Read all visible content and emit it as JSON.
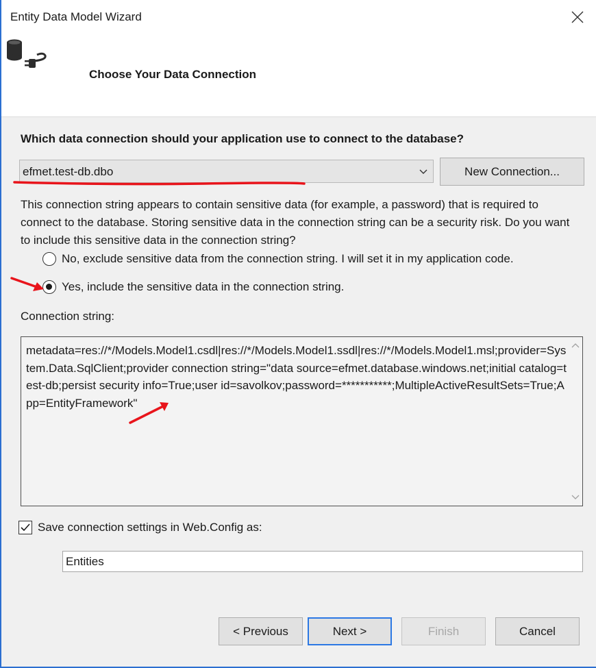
{
  "window": {
    "title": "Entity Data Model Wizard",
    "accent_color": "#2b6fd1"
  },
  "header": {
    "heading": "Choose Your Data Connection",
    "icon": "database-plug-icon"
  },
  "connection": {
    "question": "Which data connection should your application use to connect to the database?",
    "selected": "efmet.test-db.dbo",
    "new_connection_label": "New Connection..."
  },
  "sensitive": {
    "warning": "This connection string appears to contain sensitive data (for example, a password) that is required to connect to the database. Storing sensitive data in the connection string can be a security risk. Do you want to include this sensitive data in the connection string?",
    "option_no": "No, exclude sensitive data from the connection string. I will set it in my application code.",
    "option_yes": "Yes, include the sensitive data in the connection string.",
    "selected_option": "yes"
  },
  "connection_string": {
    "label": "Connection string:",
    "value": "metadata=res://*/Models.Model1.csdl|res://*/Models.Model1.ssdl|res://*/Models.Model1.msl;provider=System.Data.SqlClient;provider connection string=\"data source=efmet.database.windows.net;initial catalog=test-db;persist security info=True;user id=savolkov;password=***********;MultipleActiveResultSets=True;App=EntityFramework\""
  },
  "save": {
    "label": "Save connection settings in Web.Config as:",
    "checked": true,
    "name_value": "Entities"
  },
  "buttons": {
    "previous": "< Previous",
    "next": "Next >",
    "finish": "Finish",
    "cancel": "Cancel"
  },
  "annotation_color": "#e8141b"
}
